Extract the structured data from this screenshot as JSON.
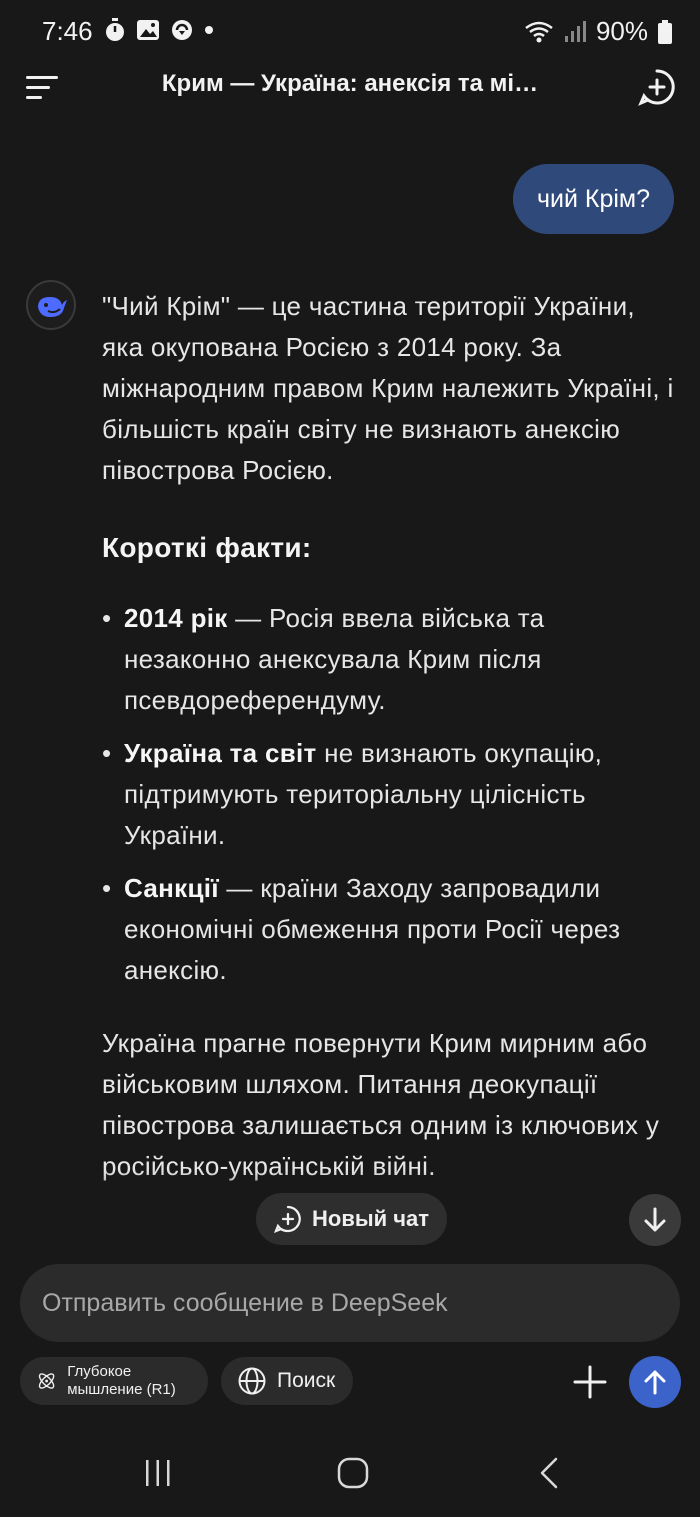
{
  "status_bar": {
    "time": "7:46",
    "battery": "90%"
  },
  "header": {
    "title": "Крим — Україна: анексія та мі…"
  },
  "user_message": "чий Крім?",
  "assistant": {
    "intro": "\"Чий Крім\" — це частина території України, яка окупована Росією з 2014 року. За міжнародним правом Крим належить Україні, і більшість країн світу не визнають анексію півострова Росією.",
    "facts_heading": "Короткі факти:",
    "facts": [
      {
        "bold": "2014 рік",
        "text": " — Росія ввела війська та незаконно анексувала Крим після псевдореферендуму."
      },
      {
        "bold": "Україна та світ",
        "text": " не визнають окупацію, підтримують територіальну цілісність України."
      },
      {
        "bold": "Санкції",
        "text": " — країни Заходу запровадили економічні обмеження проти Росії через анексію."
      }
    ],
    "closing": "Україна прагне повернути Крим мирним або військовим шляхом. Питання деокупації півострова залишається одним із ключових у російсько-українській війні."
  },
  "floating": {
    "new_chat_label": "Новый чат"
  },
  "composer": {
    "placeholder": "Отправить сообщение в DeepSeek",
    "deep_think_label": "Глубокое мышление (R1)",
    "search_label": "Поиск"
  },
  "colors": {
    "background": "#181818",
    "user_bubble": "#2f4a7a",
    "send_button": "#3b63c9",
    "brand_whale": "#4d6bfe"
  }
}
